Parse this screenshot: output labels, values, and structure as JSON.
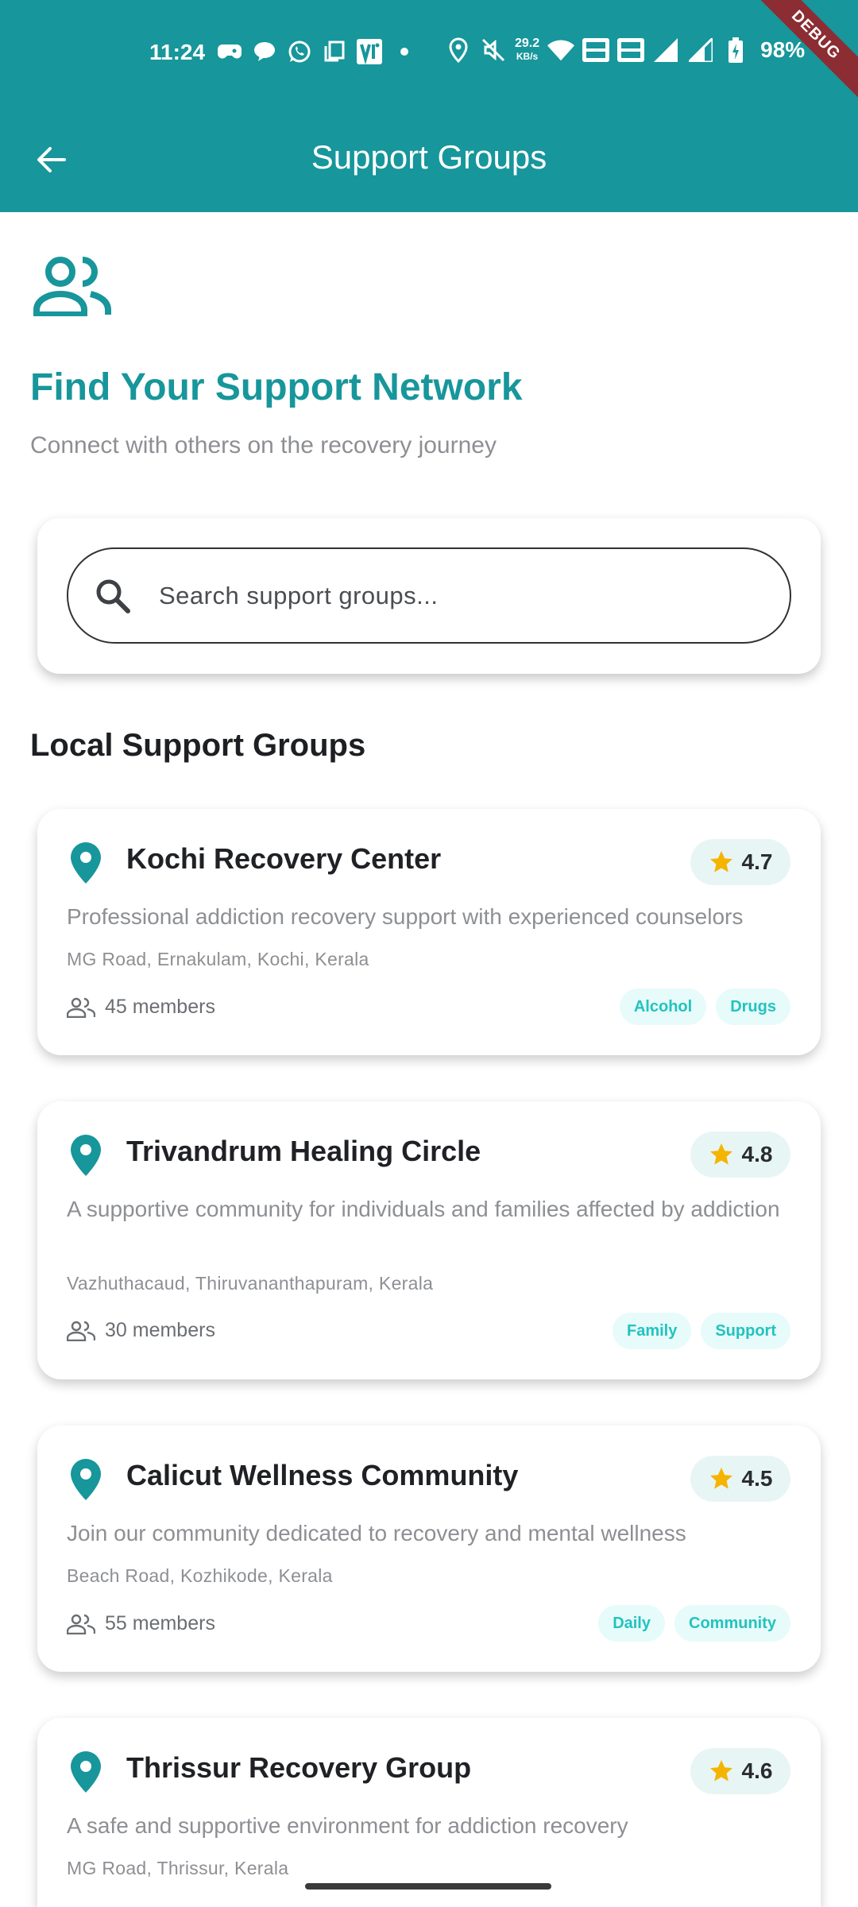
{
  "status_bar": {
    "time": "11:24",
    "speed_value": "29.2",
    "speed_unit": "KB/s",
    "battery": "98%",
    "debug_label": "DEBUG"
  },
  "app_bar": {
    "title": "Support Groups"
  },
  "hero": {
    "title": "Find Your Support Network",
    "subtitle": "Connect with others on the recovery journey"
  },
  "search": {
    "placeholder": "Search support groups..."
  },
  "section": {
    "title": "Local Support Groups"
  },
  "groups": [
    {
      "name": "Kochi Recovery Center",
      "rating": "4.7",
      "description": "Professional addiction recovery support with experienced counselors",
      "address": "MG Road, Ernakulam, Kochi, Kerala",
      "members": "45 members",
      "tags": [
        "Alcohol",
        "Drugs"
      ]
    },
    {
      "name": "Trivandrum Healing Circle",
      "rating": "4.8",
      "description": "A supportive community for individuals and families affected by addiction",
      "address": "Vazhuthacaud, Thiruvananthapuram, Kerala",
      "members": "30 members",
      "tags": [
        "Family",
        "Support"
      ]
    },
    {
      "name": "Calicut Wellness Community",
      "rating": "4.5",
      "description": "Join our community dedicated to recovery and mental wellness",
      "address": "Beach Road, Kozhikode, Kerala",
      "members": "55 members",
      "tags": [
        "Daily",
        "Community"
      ]
    },
    {
      "name": "Thrissur Recovery Group",
      "rating": "4.6",
      "description": "A safe and supportive environment for addiction recovery",
      "address": "MG Road, Thrissur, Kerala"
    }
  ],
  "colors": {
    "primary": "#17969b",
    "tag_text": "#23c3be",
    "tag_bg": "#e6fbfa",
    "star": "#f5b400",
    "debug_ribbon": "#8b2d33"
  }
}
